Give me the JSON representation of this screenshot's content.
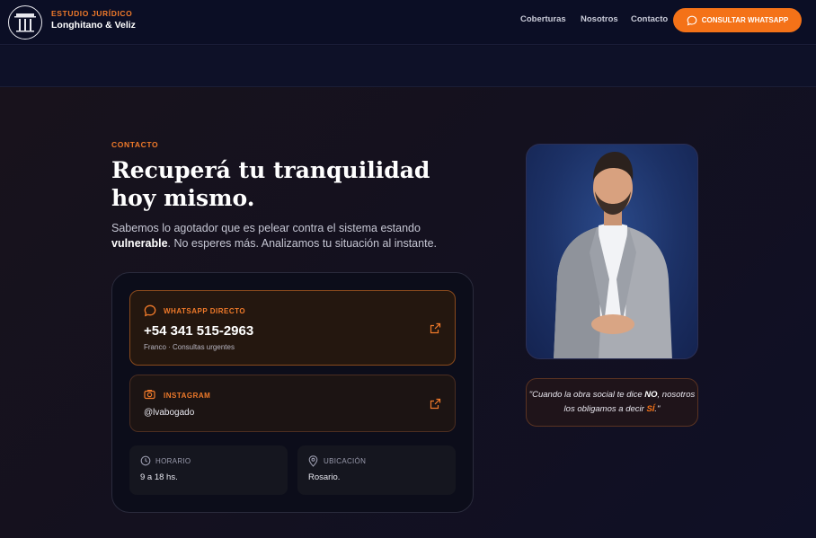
{
  "header": {
    "brand_top": "ESTUDIO JURÍDICO",
    "brand_bottom": "Longhitano & Veliz",
    "nav": [
      "Coberturas",
      "Nosotros",
      "Contacto"
    ],
    "cta_label": "CONSULTAR WHATSAPP"
  },
  "contact": {
    "eyebrow": "CONTACTO",
    "headline": "Recuperá tu tranquilidad hoy mismo.",
    "lead_part1": "Sabemos lo agotador que es pelear contra el sistema estando ",
    "lead_bold": "vulnerable",
    "lead_part2": ". No esperes más. Analizamos tu situación al instante.",
    "whatsapp": {
      "label": "WHATSAPP DIRECTO",
      "number": "+54 341 515-2963",
      "note": "Franco · Consultas urgentes"
    },
    "instagram": {
      "label": "INSTAGRAM",
      "handle": "@lvabogado"
    },
    "hours": {
      "label": "HORARIO",
      "value": "9 a 18 hs."
    },
    "location": {
      "label": "UBICACIÓN",
      "value": "Rosario."
    }
  },
  "quote": {
    "part1": "\"Cuando la obra social te dice ",
    "bold": "NO",
    "part2": ", nosotros los obligamos a decir ",
    "accent": "SÍ",
    "part3": ".\""
  },
  "colors": {
    "accent": "#f47218",
    "background": "#0d0f24"
  }
}
